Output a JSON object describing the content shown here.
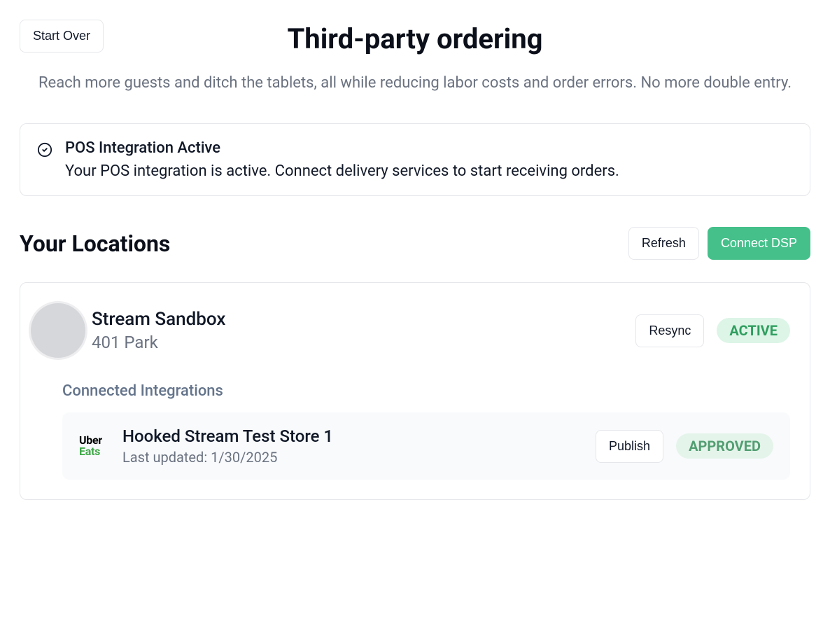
{
  "header": {
    "start_over": "Start Over",
    "title": "Third-party ordering",
    "subtitle": "Reach more guests and ditch the tablets, all while reducing labor costs and order errors. No more double entry."
  },
  "alert": {
    "title": "POS Integration Active",
    "desc": "Your POS integration is active. Connect delivery services to start receiving orders."
  },
  "locations_section": {
    "title": "Your Locations",
    "refresh": "Refresh",
    "connect_dsp": "Connect DSP"
  },
  "locations": [
    {
      "name": "Stream Sandbox",
      "address": "401 Park",
      "resync_label": "Resync",
      "status": "ACTIVE",
      "integrations_title": "Connected Integrations",
      "integrations": [
        {
          "provider": {
            "line1": "Uber",
            "line2": "Eats"
          },
          "store_name": "Hooked Stream Test Store 1",
          "last_updated_label": "Last updated: 1/30/2025",
          "publish_label": "Publish",
          "approval_status": "APPROVED"
        }
      ]
    }
  ]
}
